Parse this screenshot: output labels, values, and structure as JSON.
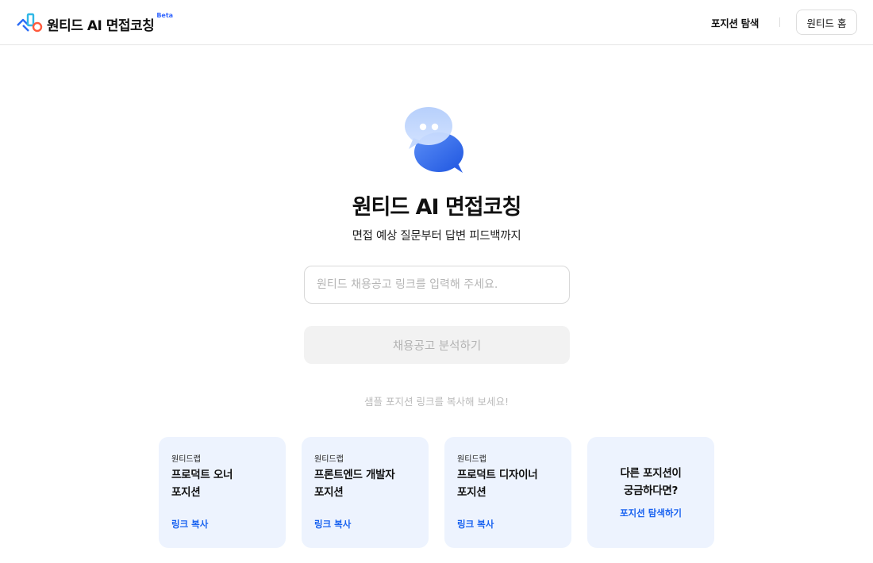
{
  "header": {
    "app_title": "원티드 AI 면접코칭",
    "beta_label": "Beta",
    "nav_explore": "포지션 탐색",
    "home_button": "원티드 홈"
  },
  "hero": {
    "title": "원티드 AI 면접코칭",
    "subtitle": "면접 예상 질문부터 답변 피드백까지"
  },
  "form": {
    "url_placeholder": "원티드 채용공고 링크를 입력해 주세요.",
    "url_value": "",
    "analyze_button": "채용공고 분석하기"
  },
  "samples": {
    "hint": "샘플 포지션 링크를 복사해 보세요!",
    "cards": [
      {
        "company": "원티드랩",
        "position_line1": "프로덕트 오너",
        "position_line2": "포지션",
        "link": "링크 복사"
      },
      {
        "company": "원티드랩",
        "position_line1": "프론트엔드 개발자",
        "position_line2": "포지션",
        "link": "링크 복사"
      },
      {
        "company": "원티드랩",
        "position_line1": "프로덕트 디자이너",
        "position_line2": "포지션",
        "link": "링크 복사"
      }
    ],
    "more": {
      "line1": "다른 포지션이",
      "line2": "궁금하다면?",
      "link": "포지션 탐색하기"
    }
  },
  "colors": {
    "accent": "#1a63f0",
    "card_bg": "#edf3fe",
    "disabled_button_bg": "#f2f2f2"
  },
  "icons": {
    "logo": "wanted-logo-icon",
    "hero": "chat-bubbles-icon"
  }
}
